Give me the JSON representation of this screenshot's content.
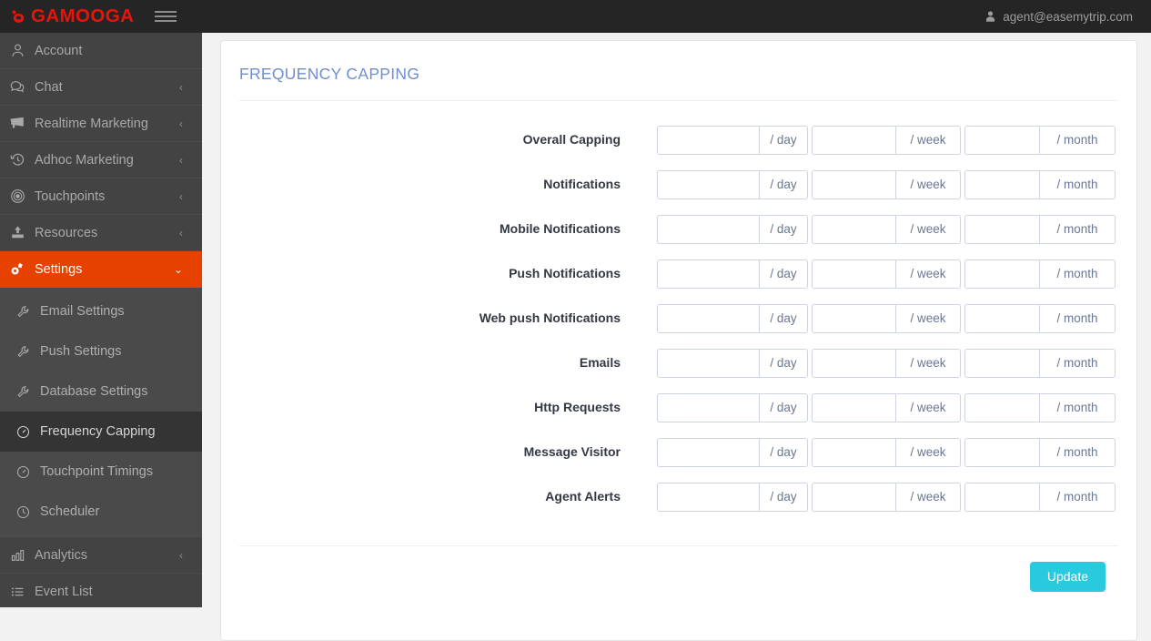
{
  "topbar": {
    "brand": "GAMOOGA",
    "brand_color": "#e8140c",
    "menu_toggle_name": "hamburger-menu",
    "user_email": "agent@easemytrip.com"
  },
  "sidebar": {
    "background": "#434343",
    "active_color": "#e74100",
    "items": [
      {
        "label": "Account",
        "icon": "user-icon",
        "caret": ""
      },
      {
        "label": "Chat",
        "icon": "chat-icon",
        "caret": "‹"
      },
      {
        "label": "Realtime Marketing",
        "icon": "megaphone-icon",
        "caret": "‹"
      },
      {
        "label": "Adhoc Marketing",
        "icon": "history-icon",
        "caret": "‹"
      },
      {
        "label": "Touchpoints",
        "icon": "bullseye-icon",
        "caret": "‹"
      },
      {
        "label": "Resources",
        "icon": "upload-icon",
        "caret": "‹"
      },
      {
        "label": "Settings",
        "icon": "gears-icon",
        "caret": "⌄"
      }
    ],
    "submenu": [
      {
        "label": "Email Settings",
        "icon": "wrench-icon"
      },
      {
        "label": "Push Settings",
        "icon": "wrench-icon"
      },
      {
        "label": "Database Settings",
        "icon": "wrench-icon"
      },
      {
        "label": "Frequency Capping",
        "icon": "gauge-icon"
      },
      {
        "label": "Touchpoint Timings",
        "icon": "gauge-icon"
      },
      {
        "label": "Scheduler",
        "icon": "clock-icon"
      }
    ],
    "items_after": [
      {
        "label": "Analytics",
        "icon": "bar-chart-icon",
        "caret": "‹"
      },
      {
        "label": "Event List",
        "icon": "list-icon",
        "caret": ""
      }
    ]
  },
  "main": {
    "title": "FREQUENCY CAPPING",
    "title_color": "#6f8ecf",
    "units": {
      "day": "/ day",
      "week": "/ week",
      "month": "/ month"
    },
    "rows": [
      {
        "label": "Overall Capping",
        "day": "",
        "week": "",
        "month": ""
      },
      {
        "label": "Notifications",
        "day": "",
        "week": "",
        "month": ""
      },
      {
        "label": "Mobile Notifications",
        "day": "",
        "week": "",
        "month": ""
      },
      {
        "label": "Push Notifications",
        "day": "",
        "week": "",
        "month": ""
      },
      {
        "label": "Web push Notifications",
        "day": "",
        "week": "",
        "month": ""
      },
      {
        "label": "Emails",
        "day": "",
        "week": "",
        "month": ""
      },
      {
        "label": "Http Requests",
        "day": "",
        "week": "",
        "month": ""
      },
      {
        "label": "Message Visitor",
        "day": "",
        "week": "",
        "month": ""
      },
      {
        "label": "Agent Alerts",
        "day": "",
        "week": "",
        "month": ""
      }
    ],
    "update_label": "Update",
    "update_color": "#29c9de"
  }
}
